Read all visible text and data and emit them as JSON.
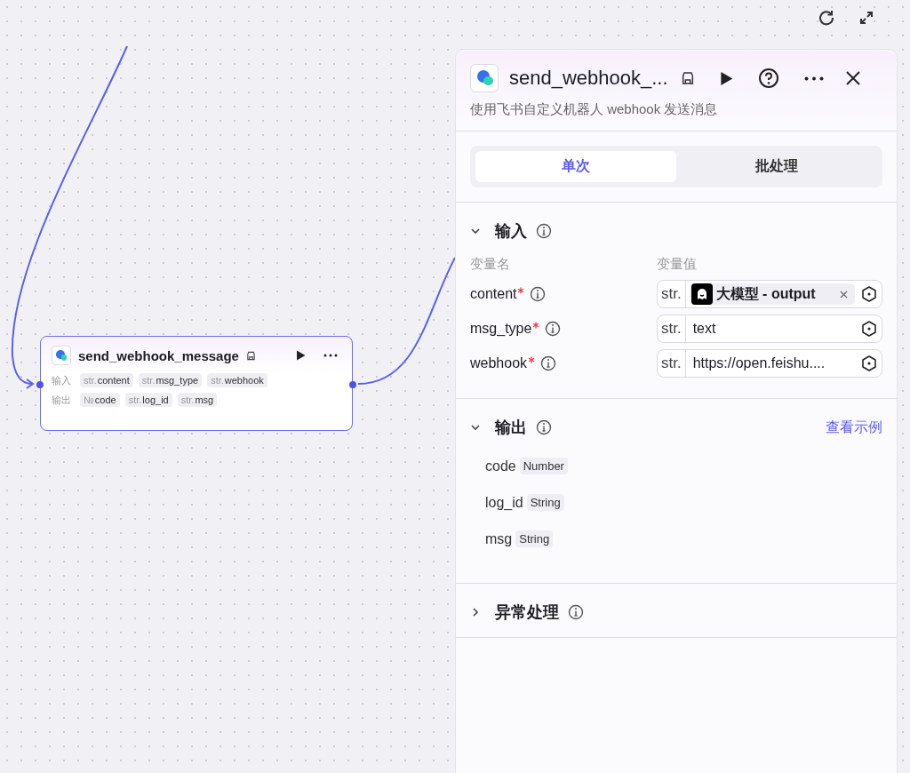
{
  "node": {
    "title": "send_webhook_message",
    "input_label": "输入",
    "inputs": [
      {
        "type": "str.",
        "name": "content"
      },
      {
        "type": "str.",
        "name": "msg_type"
      },
      {
        "type": "str.",
        "name": "webhook"
      }
    ],
    "output_label": "输出",
    "outputs": [
      {
        "type": "№",
        "name": "code"
      },
      {
        "type": "str.",
        "name": "log_id"
      },
      {
        "type": "str.",
        "name": "msg"
      }
    ]
  },
  "panel": {
    "title": "send_webhook_...",
    "description": "使用飞书自定义机器人 webhook 发送消息",
    "tabs": [
      {
        "label": "单次",
        "selected": true
      },
      {
        "label": "批处理",
        "selected": false
      }
    ],
    "input_section": {
      "title": "输入",
      "expanded": true,
      "col_name": "变量名",
      "col_value": "变量值",
      "params": [
        {
          "name": "content",
          "required": true,
          "type": "str.",
          "kind": "reference",
          "value": "大模型 - output"
        },
        {
          "name": "msg_type",
          "required": true,
          "type": "str.",
          "kind": "literal",
          "value": "text"
        },
        {
          "name": "webhook",
          "required": true,
          "type": "str.",
          "kind": "literal",
          "value": "https://open.feishu...."
        }
      ]
    },
    "output_section": {
      "title": "输出",
      "expanded": true,
      "link": "查看示例",
      "fields": [
        {
          "name": "code",
          "type": "Number"
        },
        {
          "name": "log_id",
          "type": "String"
        },
        {
          "name": "msg",
          "type": "String"
        }
      ]
    },
    "error_section": {
      "title": "异常处理",
      "expanded": false
    }
  }
}
